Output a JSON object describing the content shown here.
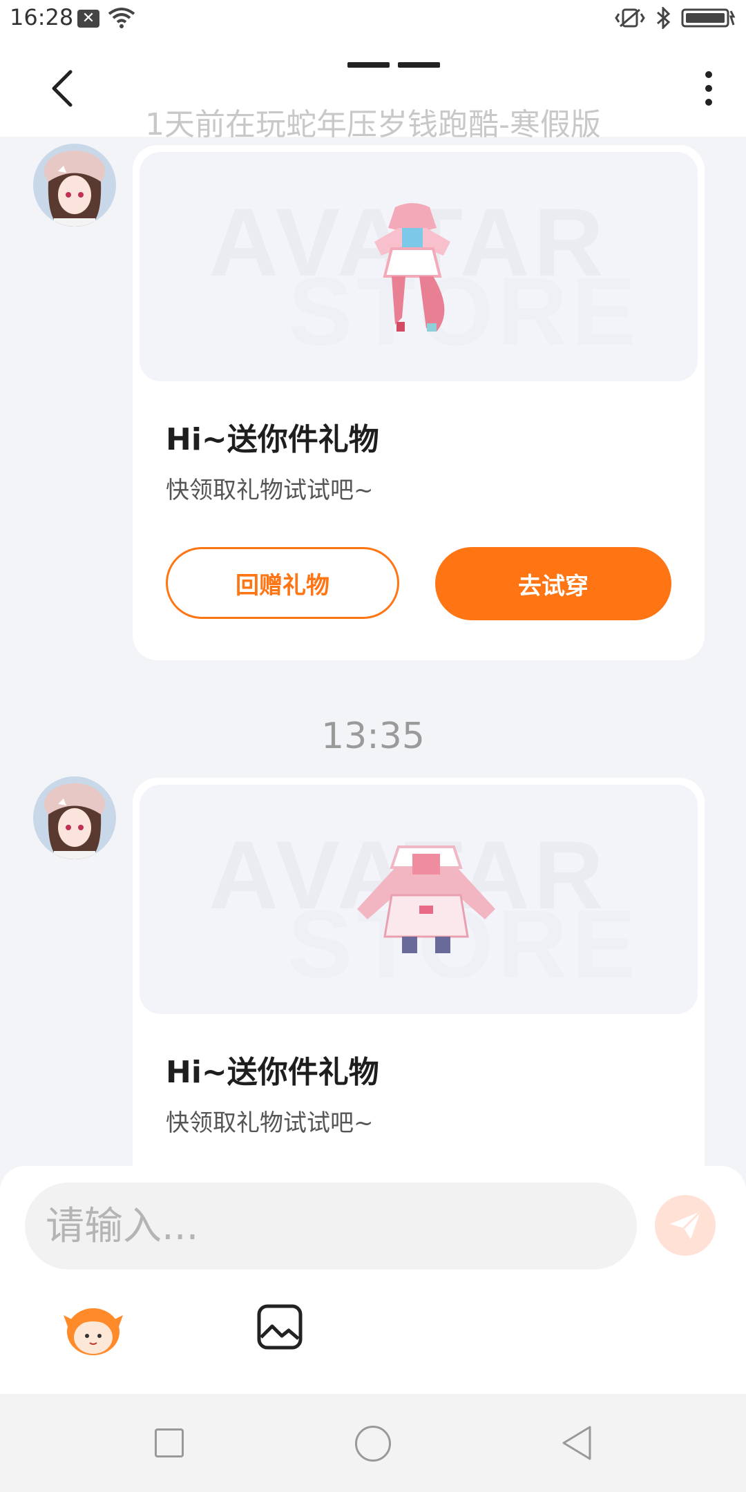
{
  "status_bar": {
    "time": "16:28",
    "icons": [
      "notification-x-icon",
      "wifi-icon",
      "vibrate-icon",
      "bluetooth-icon",
      "battery-icon"
    ]
  },
  "header": {
    "subtitle": "1天前在玩蛇年压岁钱跑酷-寒假版",
    "icons": [
      "back-arrow-icon",
      "more-vert-icon"
    ]
  },
  "messages": [
    {
      "watermark_line1": "AVATAR",
      "watermark_line2": "STORE",
      "title": "Hi~送你件礼物",
      "subtitle": "快领取礼物试试吧~",
      "return_gift_label": "回赠礼物",
      "try_on_label": "去试穿"
    },
    {
      "watermark_line1": "AVATAR",
      "watermark_line2": "STORE",
      "title": "Hi~送你件礼物",
      "subtitle": "快领取礼物试试吧~"
    }
  ],
  "timestamp": "13:35",
  "input": {
    "placeholder": "请输入..."
  },
  "colors": {
    "accent": "#ff7413",
    "background": "#f3f4f8",
    "send_disabled": "#ffe1d5"
  }
}
